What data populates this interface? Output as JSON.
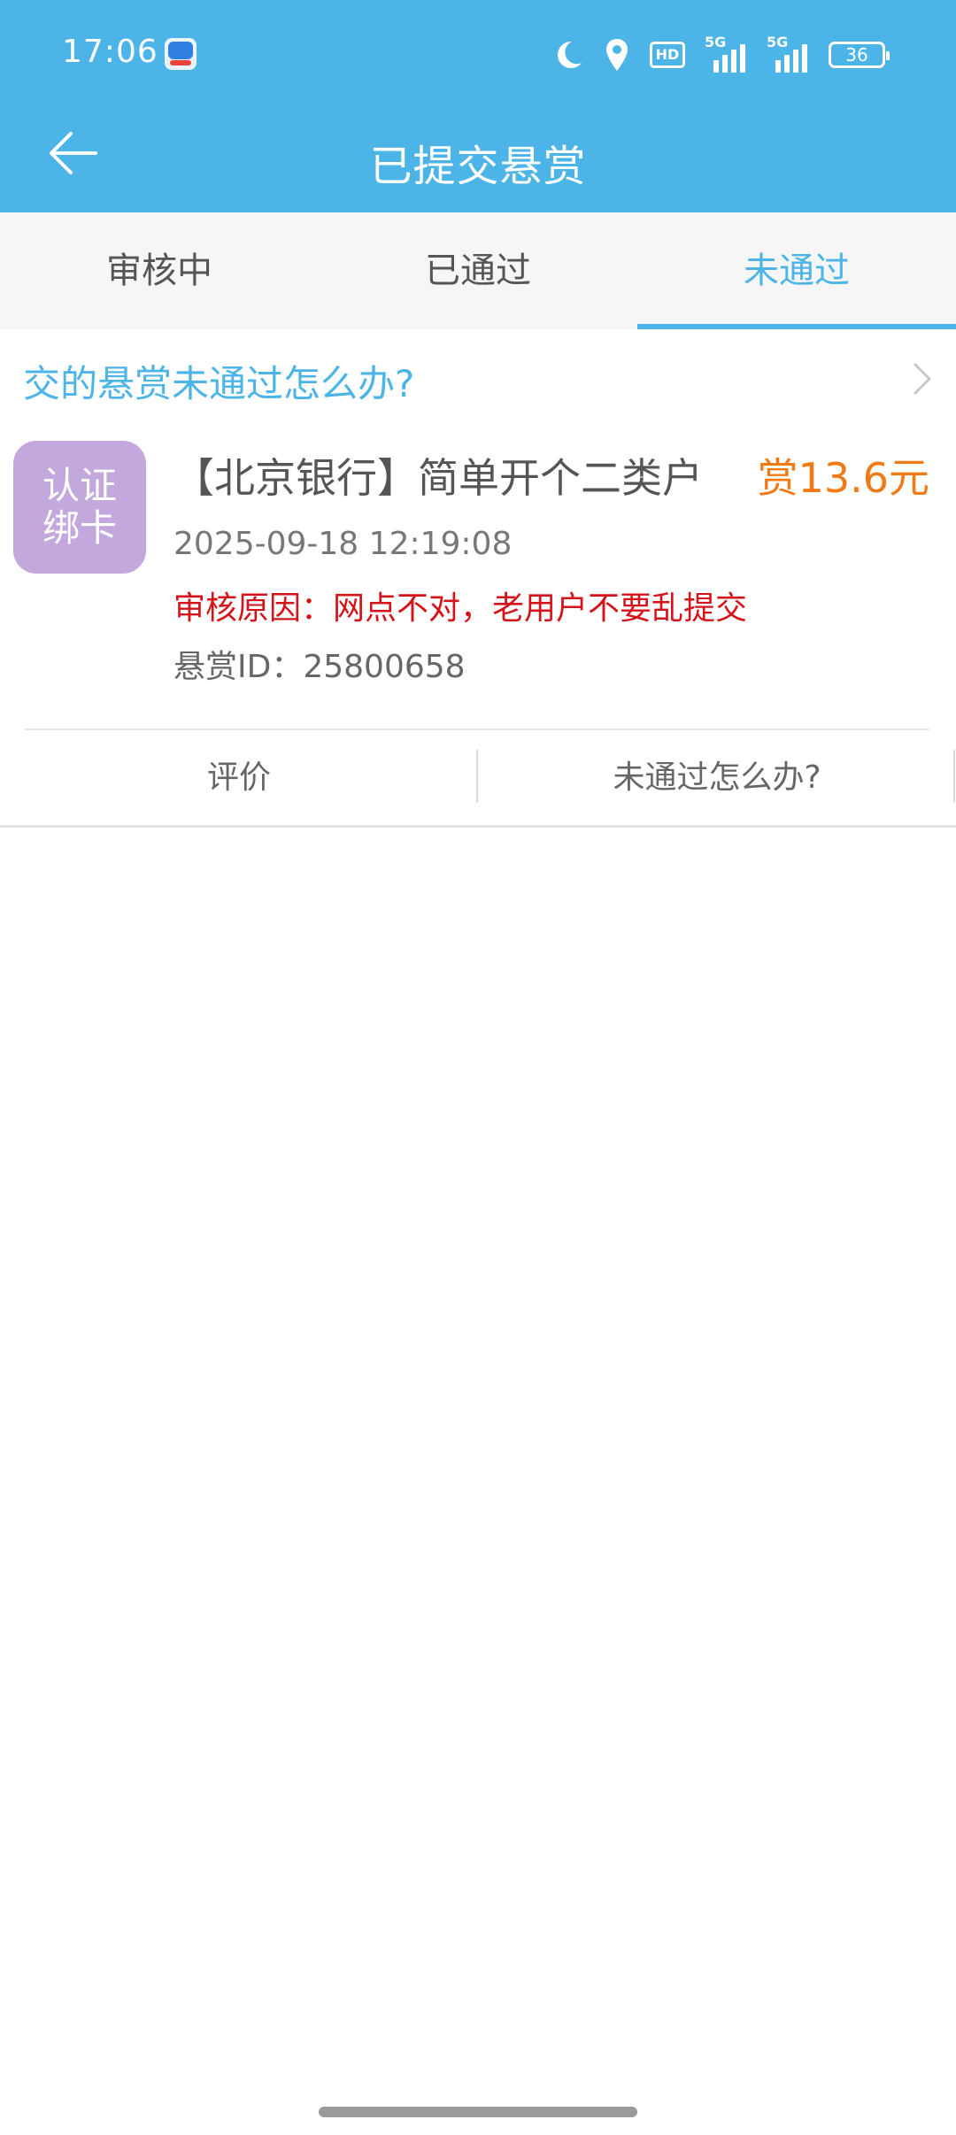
{
  "status_bar": {
    "time": "17:06",
    "network_1": "5G",
    "network_2": "5G",
    "hd_label": "HD",
    "battery": "36"
  },
  "header": {
    "title": "已提交悬赏"
  },
  "tabs": [
    {
      "label": "审核中",
      "active": false
    },
    {
      "label": "已通过",
      "active": false
    },
    {
      "label": "未通过",
      "active": true
    }
  ],
  "notice": {
    "text": "交的悬赏未通过怎么办?"
  },
  "task": {
    "icon_text_line1": "认证",
    "icon_text_line2": "绑卡",
    "title": "【北京银行】简单开个二类户",
    "reward": "赏13.6元",
    "submitted_at": "2025-09-18 12:19:08",
    "reason": "审核原因：网点不对，老用户不要乱提交",
    "reward_id": "悬赏ID：25800658",
    "actions": {
      "review": "评价",
      "help": "未通过怎么办?"
    }
  },
  "colors": {
    "primary": "#4cb4e7",
    "reward": "#f07a15",
    "reason": "#d4141a",
    "icon_bg": "#c2a8dd"
  }
}
